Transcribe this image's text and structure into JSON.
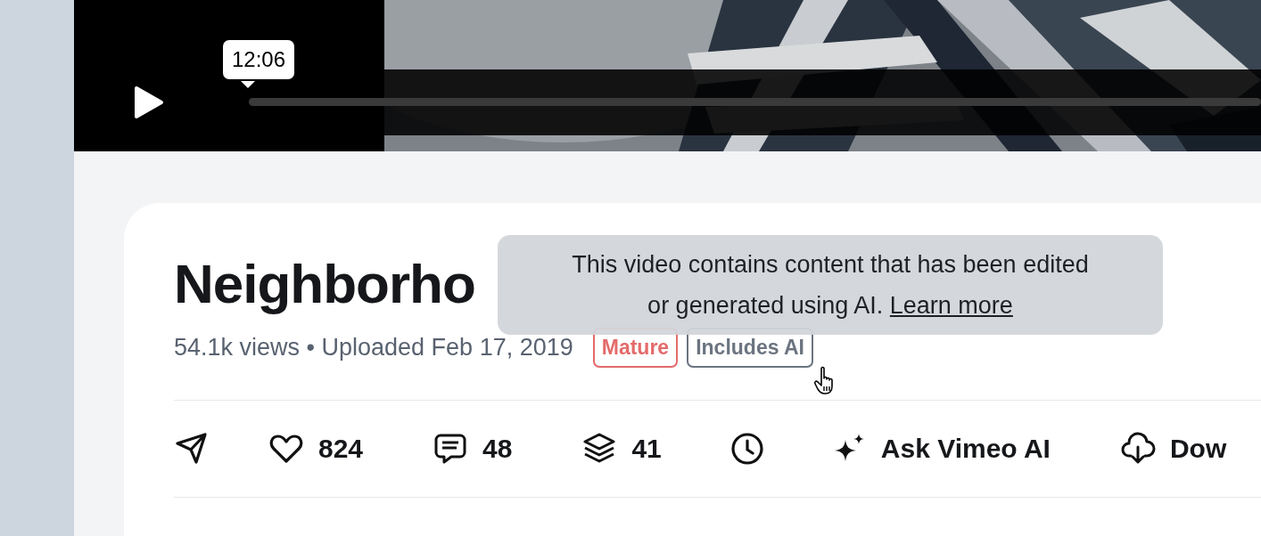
{
  "player": {
    "time_tooltip": "12:06"
  },
  "video": {
    "title": "Neighborho",
    "meta": "54.1k views • Uploaded Feb 17, 2019",
    "badges": [
      {
        "label": "Mature",
        "color": "#e46a6a"
      },
      {
        "label": "Includes AI",
        "color": "#6b7480"
      }
    ]
  },
  "tooltip": {
    "text": "This video contains content that has been edited or generated using AI.",
    "link": "Learn more"
  },
  "actions": [
    {
      "kind": "share"
    },
    {
      "kind": "like",
      "count": "824"
    },
    {
      "kind": "comments",
      "count": "48"
    },
    {
      "kind": "collections",
      "count": "41"
    },
    {
      "kind": "watch_later"
    },
    {
      "kind": "ai",
      "label": "Ask Vimeo AI"
    },
    {
      "kind": "download",
      "label": "Dow"
    }
  ]
}
